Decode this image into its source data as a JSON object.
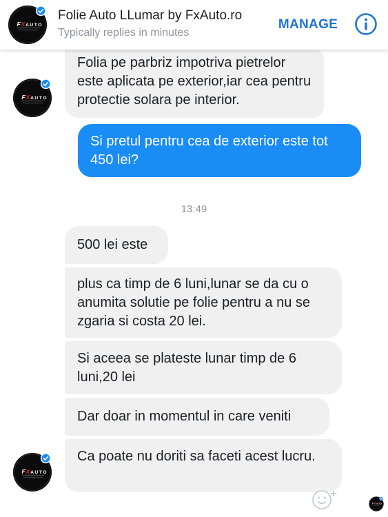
{
  "header": {
    "title": "Folie Auto LLumar by FxAuto.ro",
    "subtitle": "Typically replies in minutes",
    "manage_label": "MANAGE",
    "avatar_icon": "fxauto-logo-icon",
    "info_icon": "info-icon",
    "accent_color": "#1f74d8"
  },
  "logo": {
    "text_fx": "FX",
    "text_auto": "AUTO",
    "tagline": "SERVICII AUTO PROFESIONALE"
  },
  "messages": [
    {
      "id": "m1",
      "sender": "page",
      "text": "Folia pe parbriz impotriva pietrelor este aplicata pe exterior,iar cea pentru protectie solara pe interior."
    },
    {
      "id": "m2",
      "sender": "me",
      "text": "Si pretul pentru cea de exterior este tot 450 lei?"
    },
    {
      "id": "m3",
      "sender": "page",
      "text": "500 lei este"
    },
    {
      "id": "m4",
      "sender": "page",
      "text": "plus ca timp de 6 luni,lunar se da cu o anumita solutie pe folie pentru a nu se zgaria si costa 20 lei."
    },
    {
      "id": "m5",
      "sender": "page",
      "text": "Si aceea se plateste lunar timp de 6 luni,20 lei"
    },
    {
      "id": "m6",
      "sender": "page",
      "text": "Dar doar in momentul in care veniti"
    },
    {
      "id": "m7",
      "sender": "page",
      "text": "Ca poate nu doriti sa faceti acest lucru."
    }
  ],
  "timestamp": "13:49",
  "composer": {
    "emoji_icon": "emoji-add-reaction-icon"
  },
  "colors": {
    "my_bubble": "#1a8cf5",
    "their_bubble": "#f0f0f0",
    "header_bg": "#ffffff"
  }
}
